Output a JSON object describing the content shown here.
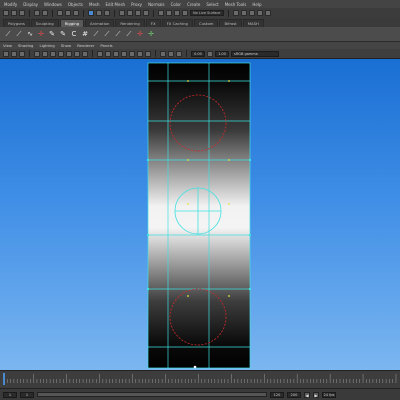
{
  "menubar": {
    "items": [
      "Modify",
      "Display",
      "Windows",
      "Objects",
      "Mesh",
      "Edit Mesh",
      "Proxy",
      "Normals",
      "Color",
      "Create",
      "Select",
      "Mesh Tools",
      "Help"
    ],
    "workspace_label": "No Live Surface"
  },
  "shelf_tabs": [
    {
      "label": "Polygons",
      "active": false
    },
    {
      "label": "Sculpting",
      "active": false
    },
    {
      "label": "Rigging",
      "active": true
    },
    {
      "label": "Animation",
      "active": false
    },
    {
      "label": "Rendering",
      "active": false
    },
    {
      "label": "FX",
      "active": false
    },
    {
      "label": "FX Caching",
      "active": false
    },
    {
      "label": "Custom",
      "active": false
    },
    {
      "label": "Bifrost",
      "active": false
    },
    {
      "label": "MASH",
      "active": false
    }
  ],
  "shelf_icons": [
    {
      "name": "joint-tool-icon",
      "glyph": "⟋",
      "tone": "plain"
    },
    {
      "name": "ik-handle-icon",
      "glyph": "⟋",
      "tone": "plain"
    },
    {
      "name": "ik-spline-icon",
      "glyph": "∿",
      "tone": "plain"
    },
    {
      "name": "locator-icon",
      "glyph": "✛",
      "tone": "red"
    },
    {
      "name": "bind-skin-icon",
      "glyph": "✎",
      "tone": "plain"
    },
    {
      "name": "paint-weights-icon",
      "glyph": "✎",
      "tone": "plain"
    },
    {
      "name": "cluster-icon",
      "glyph": "C",
      "tone": "plain"
    },
    {
      "name": "lattice-icon",
      "glyph": "#",
      "tone": "plain"
    },
    {
      "name": "blendshape-icon",
      "glyph": "⟋",
      "tone": "plain"
    },
    {
      "name": "wire-icon",
      "glyph": "⟋",
      "tone": "plain"
    },
    {
      "name": "sculpt-deformer-icon",
      "glyph": "⟋",
      "tone": "plain"
    },
    {
      "name": "wrap-icon",
      "glyph": "⟋",
      "tone": "plain"
    },
    {
      "name": "point-constraint-icon",
      "glyph": "✛",
      "tone": "red"
    },
    {
      "name": "aim-constraint-icon",
      "glyph": "✛",
      "tone": "green"
    }
  ],
  "panel_menu": [
    "View",
    "Shading",
    "Lighting",
    "Show",
    "Renderer",
    "Panels"
  ],
  "panel_tools": {
    "near_value": "0.00",
    "far_value": "1.00",
    "camera": "sRGB gamma"
  },
  "timeline": {
    "start_frame": "1",
    "end_frame": "120"
  },
  "rangebar": {
    "start": "1",
    "inner_start": "1",
    "inner_end": "120",
    "end": "200",
    "fps": "24 fps"
  }
}
